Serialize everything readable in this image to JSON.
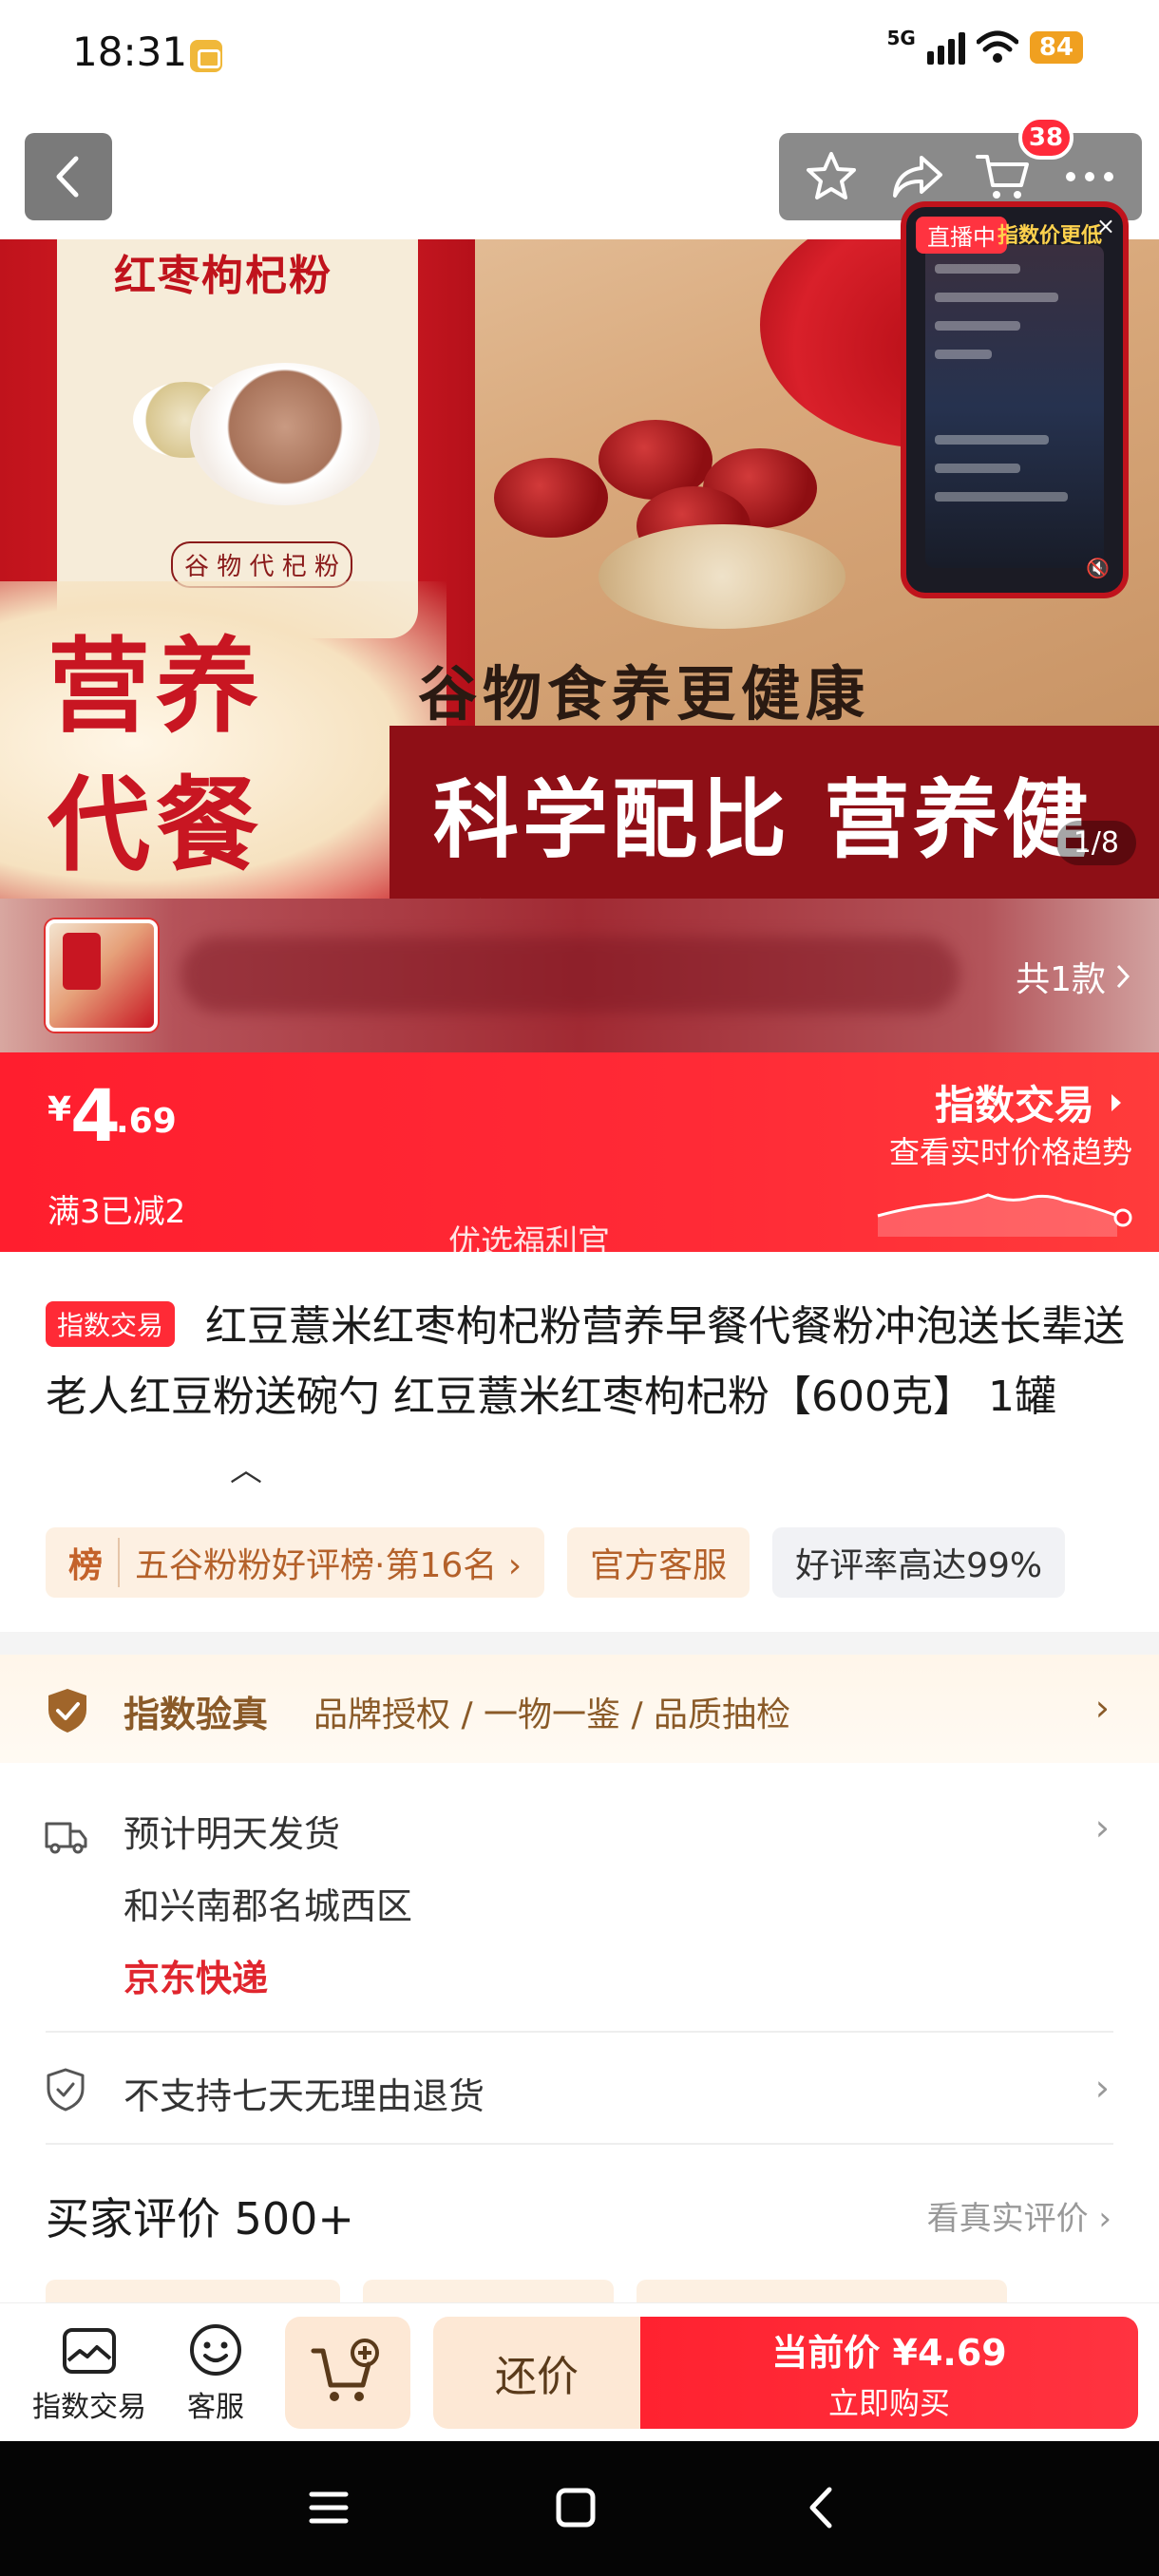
{
  "status_bar": {
    "time": "18:31",
    "network": "5G",
    "battery": "84",
    "icons": [
      "app-notification-icon",
      "signal-icon",
      "wifi-icon",
      "battery-icon"
    ]
  },
  "top_nav": {
    "cart_count": "38",
    "icons": [
      "back-icon",
      "favorite-star-icon",
      "share-icon",
      "cart-icon",
      "more-icon"
    ]
  },
  "hero": {
    "can_title": "红枣枸杞粉",
    "can_subtitle": "谷 物 代 杞 粉",
    "nutrition_line1": "营养",
    "nutrition_line2": "代餐",
    "slogan1": "谷物食养更健康",
    "slogan2": "科学配比 营养健康",
    "image_counter": "1/8"
  },
  "live_widget": {
    "tag": "直播中",
    "title": "指数价更低"
  },
  "sku": {
    "count_label": "共1款"
  },
  "price_bar": {
    "currency": "¥",
    "price_int": "4",
    "price_dec": ".69",
    "promo": "满3已减2",
    "tag": "优选福利官",
    "index_title": "指数交易",
    "index_sub": "查看实时价格趋势"
  },
  "product": {
    "badge": "指数交易",
    "title": "红豆薏米红枣枸杞粉营养早餐代餐粉冲泡送长辈送老人红豆粉送碗勺 红豆薏米红枣枸杞粉【600克】 1罐",
    "chips": {
      "rank_tag": "榜",
      "rank_text": "五谷粉粉好评榜·第16名 ›",
      "service": "官方客服",
      "good_rate": "好评率高达99%"
    }
  },
  "verify": {
    "title": "指数验真",
    "desc": "品牌授权 / 一物一鉴 / 品质抽检"
  },
  "delivery": {
    "eta": "预计明天发货",
    "location": "和兴南郡名城西区",
    "carrier": "京东快递"
  },
  "returns": {
    "text": "不支持七天无理由退货"
  },
  "reviews": {
    "title": "买家评价 500+",
    "link": "看真实评价 ›"
  },
  "action_bar": {
    "index_label": "指数交易",
    "service_label": "客服",
    "bargain_label": "还价",
    "buy_line1": "当前价 ¥4.69",
    "buy_line2": "立即购买"
  },
  "colors": {
    "primary_red": "#ff2a36",
    "accent_brown": "#8a5a28",
    "carrier_red": "#e0262e"
  }
}
